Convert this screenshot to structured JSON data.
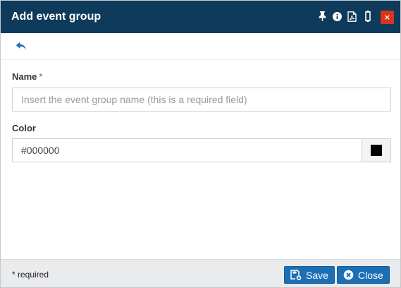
{
  "dialog": {
    "title": "Add event group",
    "titlebar_icons": [
      "pin-icon",
      "info-icon",
      "pdf-icon",
      "resize-vertical-icon",
      "close-icon"
    ],
    "close_label": "×"
  },
  "toolbar": {
    "back_icon": "back-arrow-icon"
  },
  "form": {
    "name_label": "Name",
    "name_required_marker": "*",
    "name_value": "",
    "name_placeholder": "Insert the event group name (this is a required field)",
    "color_label": "Color",
    "color_value": "#000000",
    "color_swatch": "#000000"
  },
  "footer": {
    "required_note": "* required",
    "save_label": "Save",
    "close_label": "Close"
  },
  "colors": {
    "titlebar": "#0e3a5c",
    "close_button": "#d9341c",
    "primary_button": "#1c6fb5",
    "footer_bg": "#e9ebed"
  }
}
